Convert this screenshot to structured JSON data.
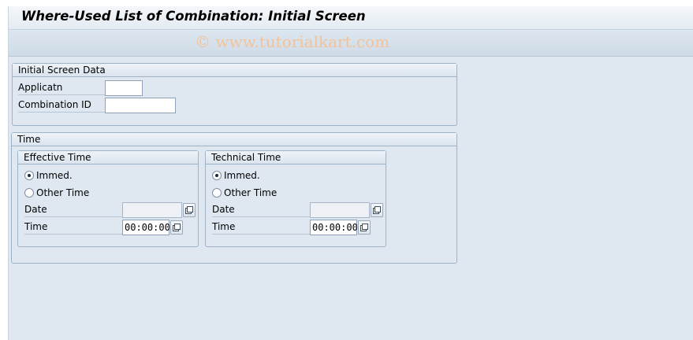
{
  "title": "Where-Used List of Combination: Initial Screen",
  "watermark": "© www.tutorialkart.com",
  "initial_screen_data": {
    "heading": "Initial Screen Data",
    "fields": [
      {
        "label": "Applicatn",
        "value": ""
      },
      {
        "label": "Combination ID",
        "value": ""
      }
    ]
  },
  "time": {
    "heading": "Time",
    "effective": {
      "heading": "Effective Time",
      "radio_immed": "Immed.",
      "radio_other": "Other Time",
      "immed_selected": true,
      "date_label": "Date",
      "date_value": "",
      "time_label": "Time",
      "time_value": "00:00:00"
    },
    "technical": {
      "heading": "Technical Time",
      "radio_immed": "Immed.",
      "radio_other": "Other Time",
      "immed_selected": true,
      "date_label": "Date",
      "date_value": "",
      "time_label": "Time",
      "time_value": "00:00:00"
    }
  },
  "icons": {
    "value_help": "value-help-icon"
  }
}
